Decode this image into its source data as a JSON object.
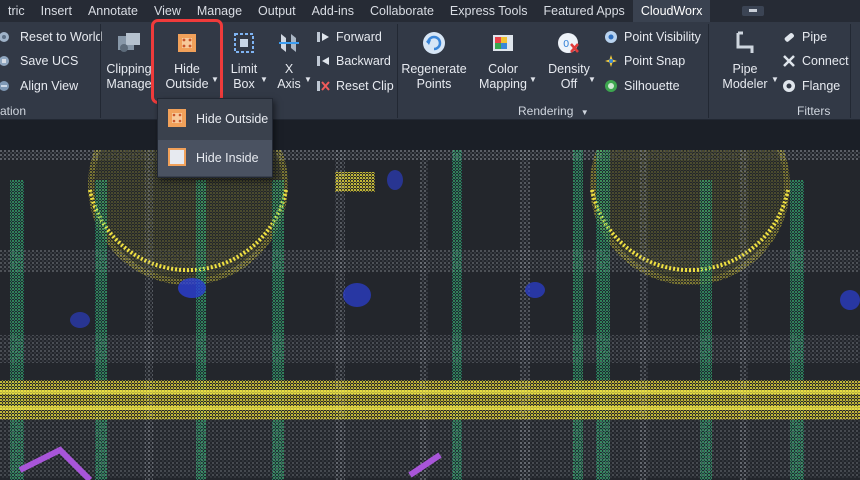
{
  "tabs": [
    "tric",
    "Insert",
    "Annotate",
    "View",
    "Manage",
    "Output",
    "Add-ins",
    "Collaborate",
    "Express Tools",
    "Featured Apps",
    "CloudWorx"
  ],
  "active_tab": "CloudWorx",
  "ucs_panel": {
    "items": [
      "Reset to World",
      "Save UCS",
      "Align View"
    ],
    "footer": "ation"
  },
  "clipping": {
    "manager_label_1": "Clipping",
    "manager_label_2": "Manage",
    "hide_outside_label_1": "Hide",
    "hide_outside_label_2": "Outside",
    "limit_box_label_1": "Limit",
    "limit_box_label_2": "Box",
    "x_axis_label_1": "X",
    "x_axis_label_2": "Axis",
    "nav_items": [
      "Forward",
      "Backward",
      "Reset Clip"
    ]
  },
  "dropdown": {
    "items": [
      "Hide Outside",
      "Hide Inside"
    ],
    "selected": "Hide Inside"
  },
  "rendering": {
    "regenerate_1": "Regenerate",
    "regenerate_2": "Points",
    "color_1": "Color",
    "color_2": "Mapping",
    "density_1": "Density",
    "density_2": "Off",
    "options": [
      "Point Visibility",
      "Point Snap",
      "Silhouette"
    ],
    "footer": "Rendering"
  },
  "fitters": {
    "pipe_modeler_1": "Pipe",
    "pipe_modeler_2": "Modeler",
    "items": [
      "Pipe",
      "Connect",
      "Flange"
    ],
    "footer": "Fitters"
  },
  "colors": {
    "highlight": "#ef3b3b",
    "ribbon": "#323946",
    "active_tab": "#3a4250"
  }
}
